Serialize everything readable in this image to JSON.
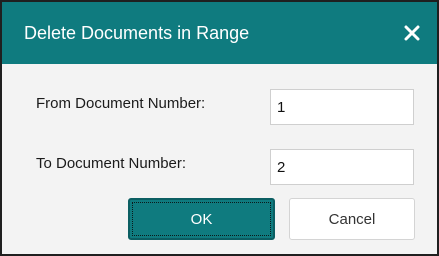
{
  "dialog": {
    "title": "Delete Documents in Range",
    "close_icon": "close-icon",
    "accent_color": "#0f7b7f"
  },
  "form": {
    "from_label": "From Document Number:",
    "from_value": "1",
    "to_label": "To Document Number:",
    "to_value": "2"
  },
  "buttons": {
    "ok_label": "OK",
    "cancel_label": "Cancel"
  }
}
